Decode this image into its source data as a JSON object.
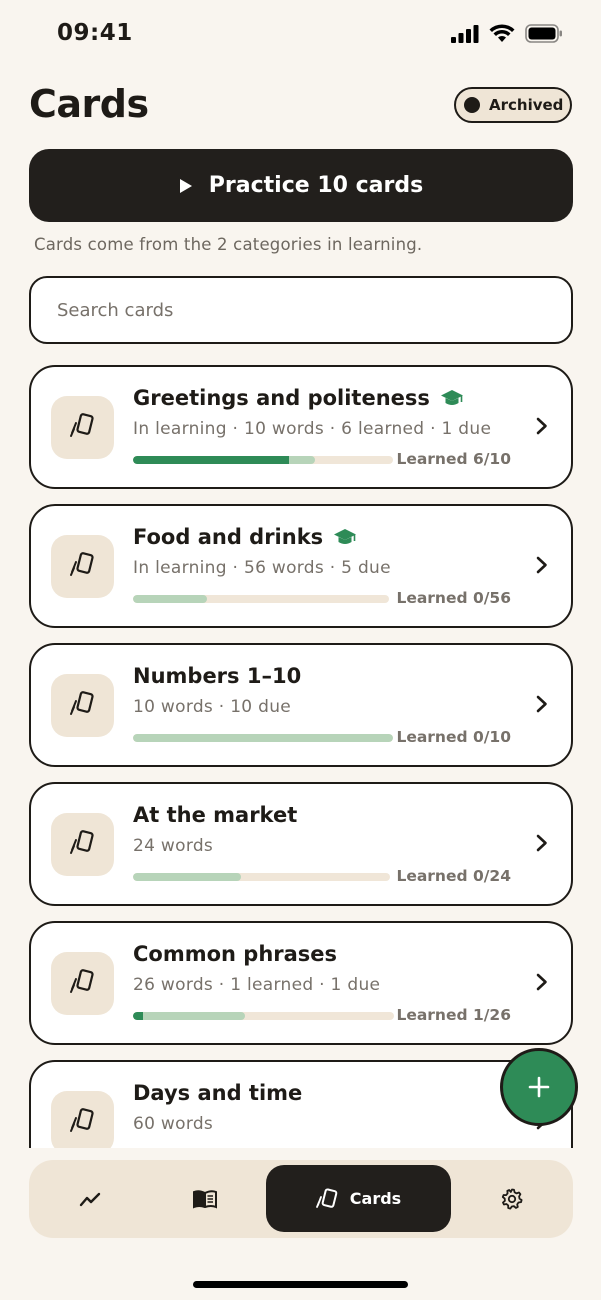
{
  "status_bar": {
    "time": "09:41",
    "icons": [
      "cellular-signal-icon",
      "wifi-icon",
      "battery-icon"
    ]
  },
  "header": {
    "title": "Cards",
    "archived_label": "Archived"
  },
  "practice": {
    "button_label": "Practice 10 cards",
    "note": "Cards come from the 2 categories in learning."
  },
  "search": {
    "placeholder": "Search cards",
    "value": ""
  },
  "categories": [
    {
      "title": "Greetings and politeness",
      "in_learning": true,
      "meta": "In learning · 10 words · 6 learned · 1 due",
      "learned_label": "Learned 6/10",
      "learned_fraction": 0.6,
      "due_fraction": 0.7
    },
    {
      "title": "Food and drinks",
      "in_learning": true,
      "meta": "In learning · 56 words · 5 due",
      "learned_label": "Learned 0/56",
      "learned_fraction": 0.0,
      "due_fraction": 0.29
    },
    {
      "title": "Numbers 1–10",
      "in_learning": false,
      "meta": "10 words · 10 due",
      "learned_label": "Learned 0/10",
      "learned_fraction": 0.0,
      "due_fraction": 1.0
    },
    {
      "title": "At the market",
      "in_learning": false,
      "meta": "24 words",
      "learned_label": "Learned 0/24",
      "learned_fraction": 0.0,
      "due_fraction": 0.42
    },
    {
      "title": "Common phrases",
      "in_learning": false,
      "meta": "26 words · 1 learned · 1 due",
      "learned_label": "Learned 1/26",
      "learned_fraction": 0.04,
      "due_fraction": 0.43
    },
    {
      "title": "Days and time",
      "in_learning": false,
      "meta": "60 words"
    }
  ],
  "tab_bar": {
    "tabs": [
      {
        "icon": "stats-chart-icon"
      },
      {
        "icon": "book-icon"
      },
      {
        "icon": "cards-icon",
        "label": "Cards",
        "active": true
      },
      {
        "icon": "gear-icon"
      }
    ]
  },
  "colors": {
    "background": "#f9f5ef",
    "ink": "#1e1b17",
    "accent_green": "#2e8b57",
    "due_green": "#b7d4b9",
    "chip": "#efe5d6"
  }
}
